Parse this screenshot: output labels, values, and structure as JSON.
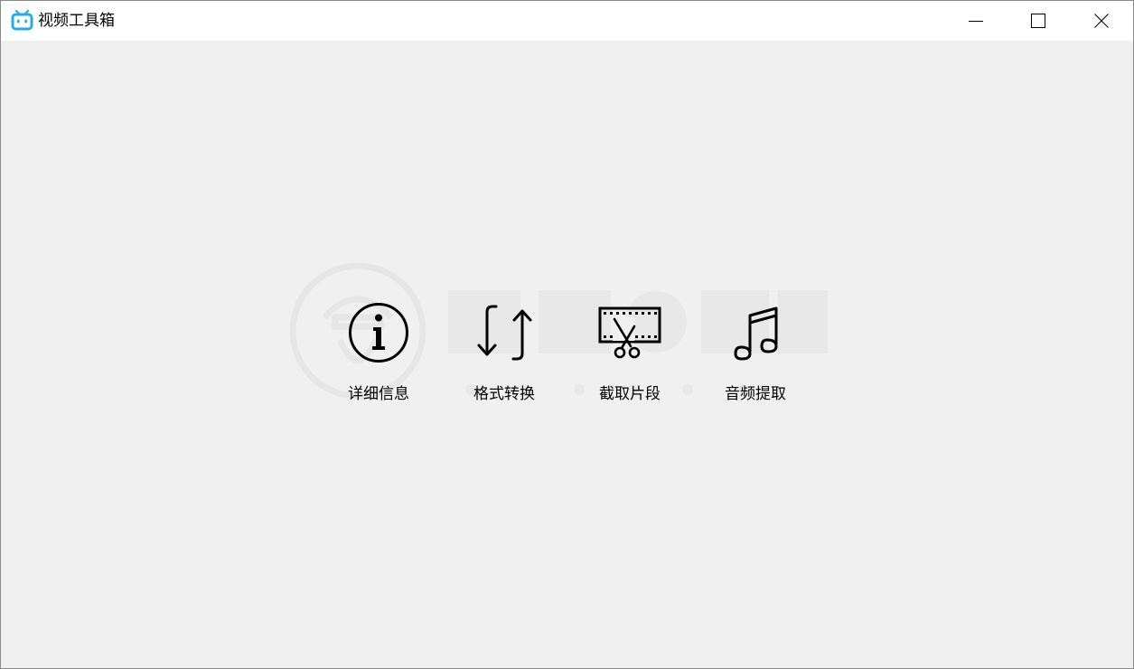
{
  "window": {
    "title": "视频工具箱",
    "app_icon": "bilibili-tv-icon",
    "accent_color": "#23ade5",
    "background_color": "#f0f0f0",
    "controls": {
      "minimize": "minimize-icon",
      "maximize": "maximize-icon",
      "close": "close-icon"
    }
  },
  "tools": [
    {
      "label": "详细信息",
      "icon": "info-icon"
    },
    {
      "label": "格式转换",
      "icon": "convert-arrows-icon"
    },
    {
      "label": "截取片段",
      "icon": "film-scissors-icon"
    },
    {
      "label": "音频提取",
      "icon": "music-note-icon"
    }
  ]
}
